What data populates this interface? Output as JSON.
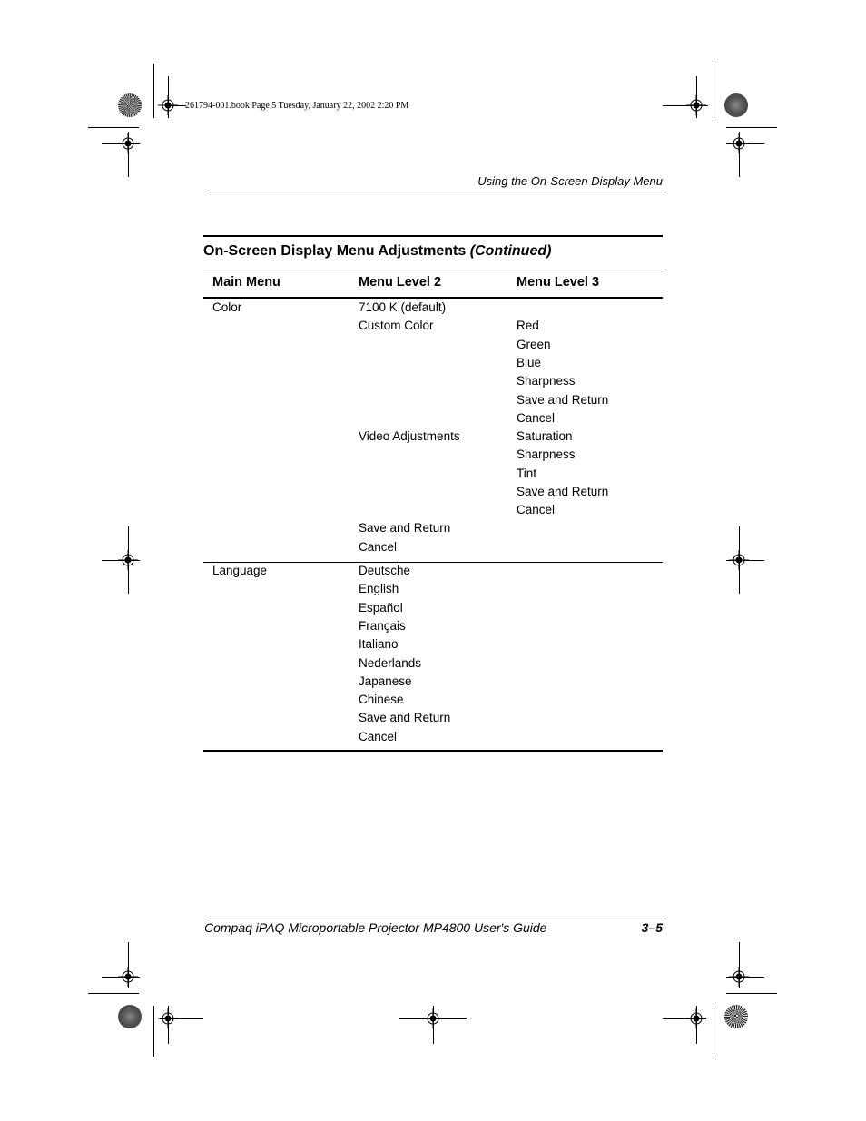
{
  "slug": "261794-001.book  Page 5  Tuesday, January 22, 2002  2:20 PM",
  "running_head": "Using the On-Screen Display Menu",
  "table": {
    "title": "On-Screen Display Menu Adjustments",
    "title_suffix": "(Continued)",
    "columns": [
      "Main Menu",
      "Menu Level 2",
      "Menu Level 3"
    ],
    "color_group": {
      "main": "Color",
      "level2": [
        "7100 K (default)",
        "Custom Color",
        "Video Adjustments",
        "Save and Return",
        "Cancel"
      ],
      "custom_color_level3": [
        "Red",
        "Green",
        "Blue",
        "Sharpness",
        "Save and Return",
        "Cancel"
      ],
      "video_adjustments_level3": [
        "Saturation",
        "Sharpness",
        "Tint",
        "Save and Return",
        "Cancel"
      ]
    },
    "language_group": {
      "main": "Language",
      "level2": [
        "Deutsche",
        "English",
        "Español",
        "Français",
        "Italiano",
        "Nederlands",
        "Japanese",
        "Chinese",
        "Save and Return",
        "Cancel"
      ]
    }
  },
  "footer": {
    "title": "Compaq iPAQ Microportable Projector MP4800 User's Guide",
    "page": "3–5"
  },
  "icons": {
    "registration_mark": "crosshair-circle",
    "color_disc": "printer-color-bar"
  }
}
